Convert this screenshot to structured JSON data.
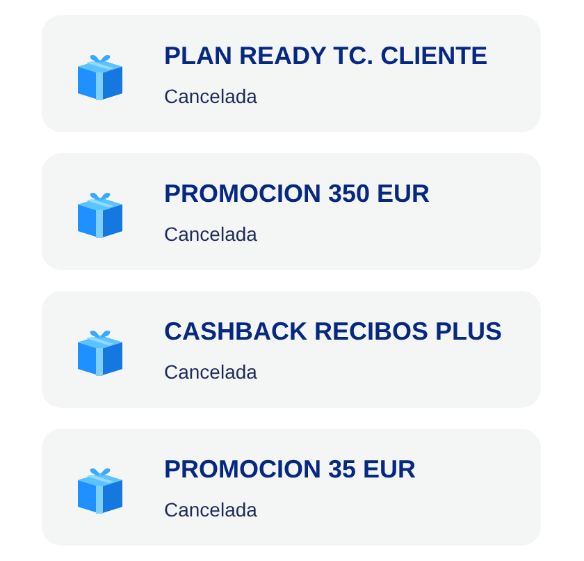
{
  "promotions": [
    {
      "title": "PLAN READY TC. CLIENTE",
      "status": "Cancelada"
    },
    {
      "title": "PROMOCION 350 EUR",
      "status": "Cancelada"
    },
    {
      "title": "CASHBACK RECIBOS PLUS",
      "status": "Cancelada"
    },
    {
      "title": "PROMOCION 35 EUR",
      "status": "Cancelada"
    }
  ]
}
